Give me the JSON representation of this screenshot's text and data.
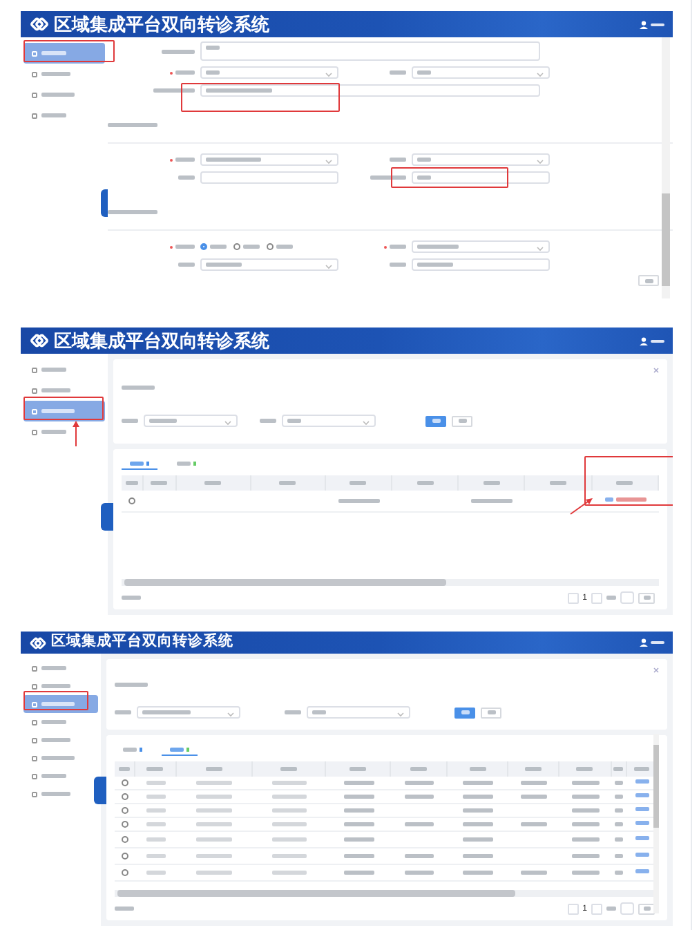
{
  "screens": [
    {
      "kind": "form",
      "title": "区域集成平台双向转诊系统",
      "sidebar": [
        {
          "selected": true
        },
        {
          "selected": false
        },
        {
          "selected": false
        },
        {
          "selected": false
        }
      ],
      "radios": [
        {
          "selected": true
        },
        {
          "selected": false
        },
        {
          "selected": false
        }
      ]
    },
    {
      "kind": "list",
      "title": "区域集成平台双向转诊系统",
      "sidebar": [
        {
          "selected": false
        },
        {
          "selected": false
        },
        {
          "selected": true
        },
        {
          "selected": false
        }
      ],
      "tabs": [
        {
          "selected": true
        },
        {
          "selected": false
        }
      ],
      "rows": [
        {
          "selected": false
        }
      ],
      "page": "1"
    },
    {
      "kind": "list",
      "title": "区域集成平台双向转诊系统",
      "sidebar": [
        {
          "selected": false
        },
        {
          "selected": false
        },
        {
          "selected": true
        },
        {
          "selected": false
        },
        {
          "selected": false
        },
        {
          "selected": false
        },
        {
          "selected": false
        },
        {
          "selected": false
        }
      ],
      "tabs": [
        {
          "selected": false
        },
        {
          "selected": true
        }
      ],
      "rows": [
        {
          "selected": false
        },
        {
          "selected": false
        },
        {
          "selected": false
        },
        {
          "selected": false
        },
        {
          "selected": false
        },
        {
          "selected": false
        },
        {
          "selected": false
        }
      ],
      "page": "1"
    }
  ]
}
